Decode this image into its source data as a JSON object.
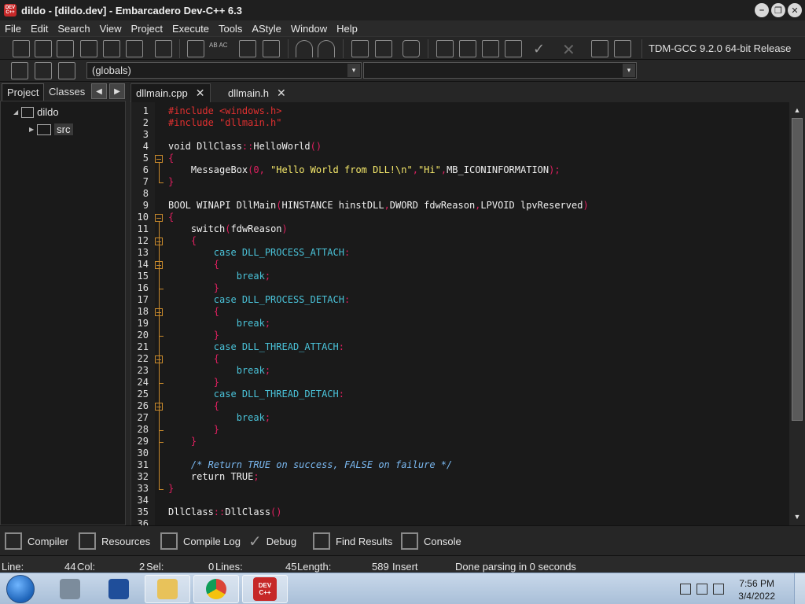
{
  "window": {
    "title": "dildo - [dildo.dev] - Embarcadero Dev-C++ 6.3",
    "icon_text": "DEV C++",
    "controls": [
      "–",
      "❐",
      "✕"
    ]
  },
  "menu": [
    "File",
    "Edit",
    "Search",
    "View",
    "Project",
    "Execute",
    "Tools",
    "AStyle",
    "Window",
    "Help"
  ],
  "toolbar": {
    "compiler": "TDM-GCC 9.2.0 64-bit Release",
    "replace_icon_text": "AB AC",
    "scope_select": "(globals)",
    "dropdown_arrow": "▾"
  },
  "left_panel": {
    "tabs": [
      "Project",
      "Classes"
    ],
    "nav_prev": "◀",
    "nav_next": "▶",
    "tree": {
      "root": "dildo",
      "child": "src",
      "root_toggle": "◢",
      "child_toggle": "▶"
    }
  },
  "editor": {
    "tabs": [
      {
        "label": "dllmain.cpp",
        "close": "✕"
      },
      {
        "label": "dllmain.h",
        "close": "✕"
      }
    ],
    "line_numbers": [
      "1",
      "2",
      "3",
      "4",
      "5",
      "6",
      "7",
      "8",
      "9",
      "10",
      "11",
      "12",
      "13",
      "14",
      "15",
      "16",
      "17",
      "18",
      "19",
      "20",
      "21",
      "22",
      "23",
      "24",
      "25",
      "26",
      "27",
      "28",
      "29",
      "30",
      "31",
      "32",
      "33",
      "34",
      "35",
      "36"
    ],
    "lines": [
      {
        "indent": "",
        "tokens": [
          {
            "t": "#include <windows.h>",
            "c": "pre"
          }
        ]
      },
      {
        "indent": "",
        "tokens": [
          {
            "t": "#include \"dllmain.h\"",
            "c": "pre"
          }
        ]
      },
      {
        "indent": "",
        "tokens": []
      },
      {
        "indent": "",
        "tokens": [
          {
            "t": "void DllClass",
            "c": "kw"
          },
          {
            "t": "::",
            "c": "punct"
          },
          {
            "t": "HelloWorld",
            "c": "kw"
          },
          {
            "t": "()",
            "c": "punct"
          }
        ]
      },
      {
        "indent": "",
        "tokens": [
          {
            "t": "{",
            "c": "punct"
          }
        ]
      },
      {
        "indent": "    ",
        "tokens": [
          {
            "t": "MessageBox",
            "c": "kw"
          },
          {
            "t": "(",
            "c": "punct"
          },
          {
            "t": "0",
            "c": "num"
          },
          {
            "t": ", ",
            "c": "punct"
          },
          {
            "t": "\"Hello World from DLL!\\n\"",
            "c": "str"
          },
          {
            "t": ",",
            "c": "punct"
          },
          {
            "t": "\"Hi\"",
            "c": "str"
          },
          {
            "t": ",",
            "c": "punct"
          },
          {
            "t": "MB_ICONINFORMATION",
            "c": "kw"
          },
          {
            "t": ");",
            "c": "punct"
          }
        ]
      },
      {
        "indent": "",
        "tokens": [
          {
            "t": "}",
            "c": "punct"
          }
        ]
      },
      {
        "indent": "",
        "tokens": []
      },
      {
        "indent": "",
        "tokens": [
          {
            "t": "BOOL WINAPI DllMain",
            "c": "kw"
          },
          {
            "t": "(",
            "c": "punct"
          },
          {
            "t": "HINSTANCE hinstDLL",
            "c": "kw"
          },
          {
            "t": ",",
            "c": "punct"
          },
          {
            "t": "DWORD fdwReason",
            "c": "kw"
          },
          {
            "t": ",",
            "c": "punct"
          },
          {
            "t": "LPVOID lpvReserved",
            "c": "kw"
          },
          {
            "t": ")",
            "c": "punct"
          }
        ]
      },
      {
        "indent": "",
        "tokens": [
          {
            "t": "{",
            "c": "punct"
          }
        ]
      },
      {
        "indent": "    ",
        "tokens": [
          {
            "t": "switch",
            "c": "kw"
          },
          {
            "t": "(",
            "c": "punct"
          },
          {
            "t": "fdwReason",
            "c": "kw"
          },
          {
            "t": ")",
            "c": "punct"
          }
        ]
      },
      {
        "indent": "    ",
        "tokens": [
          {
            "t": "{",
            "c": "punct"
          }
        ]
      },
      {
        "indent": "        ",
        "tokens": [
          {
            "t": "case DLL_PROCESS_ATTACH",
            "c": "case"
          },
          {
            "t": ":",
            "c": "punct"
          }
        ]
      },
      {
        "indent": "        ",
        "tokens": [
          {
            "t": "{",
            "c": "punct"
          }
        ]
      },
      {
        "indent": "            ",
        "tokens": [
          {
            "t": "break",
            "c": "case"
          },
          {
            "t": ";",
            "c": "punct"
          }
        ]
      },
      {
        "indent": "        ",
        "tokens": [
          {
            "t": "}",
            "c": "punct"
          }
        ]
      },
      {
        "indent": "        ",
        "tokens": [
          {
            "t": "case DLL_PROCESS_DETACH",
            "c": "case"
          },
          {
            "t": ":",
            "c": "punct"
          }
        ]
      },
      {
        "indent": "        ",
        "tokens": [
          {
            "t": "{",
            "c": "punct"
          }
        ]
      },
      {
        "indent": "            ",
        "tokens": [
          {
            "t": "break",
            "c": "case"
          },
          {
            "t": ";",
            "c": "punct"
          }
        ]
      },
      {
        "indent": "        ",
        "tokens": [
          {
            "t": "}",
            "c": "punct"
          }
        ]
      },
      {
        "indent": "        ",
        "tokens": [
          {
            "t": "case DLL_THREAD_ATTACH",
            "c": "case"
          },
          {
            "t": ":",
            "c": "punct"
          }
        ]
      },
      {
        "indent": "        ",
        "tokens": [
          {
            "t": "{",
            "c": "punct"
          }
        ]
      },
      {
        "indent": "            ",
        "tokens": [
          {
            "t": "break",
            "c": "case"
          },
          {
            "t": ";",
            "c": "punct"
          }
        ]
      },
      {
        "indent": "        ",
        "tokens": [
          {
            "t": "}",
            "c": "punct"
          }
        ]
      },
      {
        "indent": "        ",
        "tokens": [
          {
            "t": "case DLL_THREAD_DETACH",
            "c": "case"
          },
          {
            "t": ":",
            "c": "punct"
          }
        ]
      },
      {
        "indent": "        ",
        "tokens": [
          {
            "t": "{",
            "c": "punct"
          }
        ]
      },
      {
        "indent": "            ",
        "tokens": [
          {
            "t": "break",
            "c": "case"
          },
          {
            "t": ";",
            "c": "punct"
          }
        ]
      },
      {
        "indent": "        ",
        "tokens": [
          {
            "t": "}",
            "c": "punct"
          }
        ]
      },
      {
        "indent": "    ",
        "tokens": [
          {
            "t": "}",
            "c": "punct"
          }
        ]
      },
      {
        "indent": "",
        "tokens": []
      },
      {
        "indent": "    ",
        "tokens": [
          {
            "t": "/* Return TRUE on success, FALSE on failure */",
            "c": "comment"
          }
        ]
      },
      {
        "indent": "    ",
        "tokens": [
          {
            "t": "return TRUE",
            "c": "kw"
          },
          {
            "t": ";",
            "c": "punct"
          }
        ]
      },
      {
        "indent": "",
        "tokens": [
          {
            "t": "}",
            "c": "punct"
          }
        ]
      },
      {
        "indent": "",
        "tokens": []
      },
      {
        "indent": "",
        "tokens": [
          {
            "t": "DllClass",
            "c": "kw"
          },
          {
            "t": "::",
            "c": "punct"
          },
          {
            "t": "DllClass",
            "c": "kw"
          },
          {
            "t": "()",
            "c": "punct"
          }
        ]
      }
    ],
    "colors": {
      "pre": "#e03030",
      "keyword": "#f0f0f0",
      "punct": "#e02060",
      "string": "#f5e86a",
      "case": "#4ac2d8",
      "comment": "#7ab8f0",
      "fold": "#c98a2c"
    }
  },
  "bottom_tabs": [
    "Compiler",
    "Resources",
    "Compile Log",
    "Debug",
    "Find Results",
    "Console"
  ],
  "status": {
    "line_label": "Line:",
    "line_value": "44",
    "col_label": "Col:",
    "col_value": "2",
    "sel_label": "Sel:",
    "sel_value": "0",
    "lines_label": "Lines:",
    "lines_value": "45",
    "length_label": "Length:",
    "length_value": "589",
    "mode": "Insert",
    "message": "Done parsing in 0 seconds"
  },
  "taskbar": {
    "time": "7:56 PM",
    "date": "3/4/2022",
    "devcpp_icon_text": "DEV C++"
  }
}
